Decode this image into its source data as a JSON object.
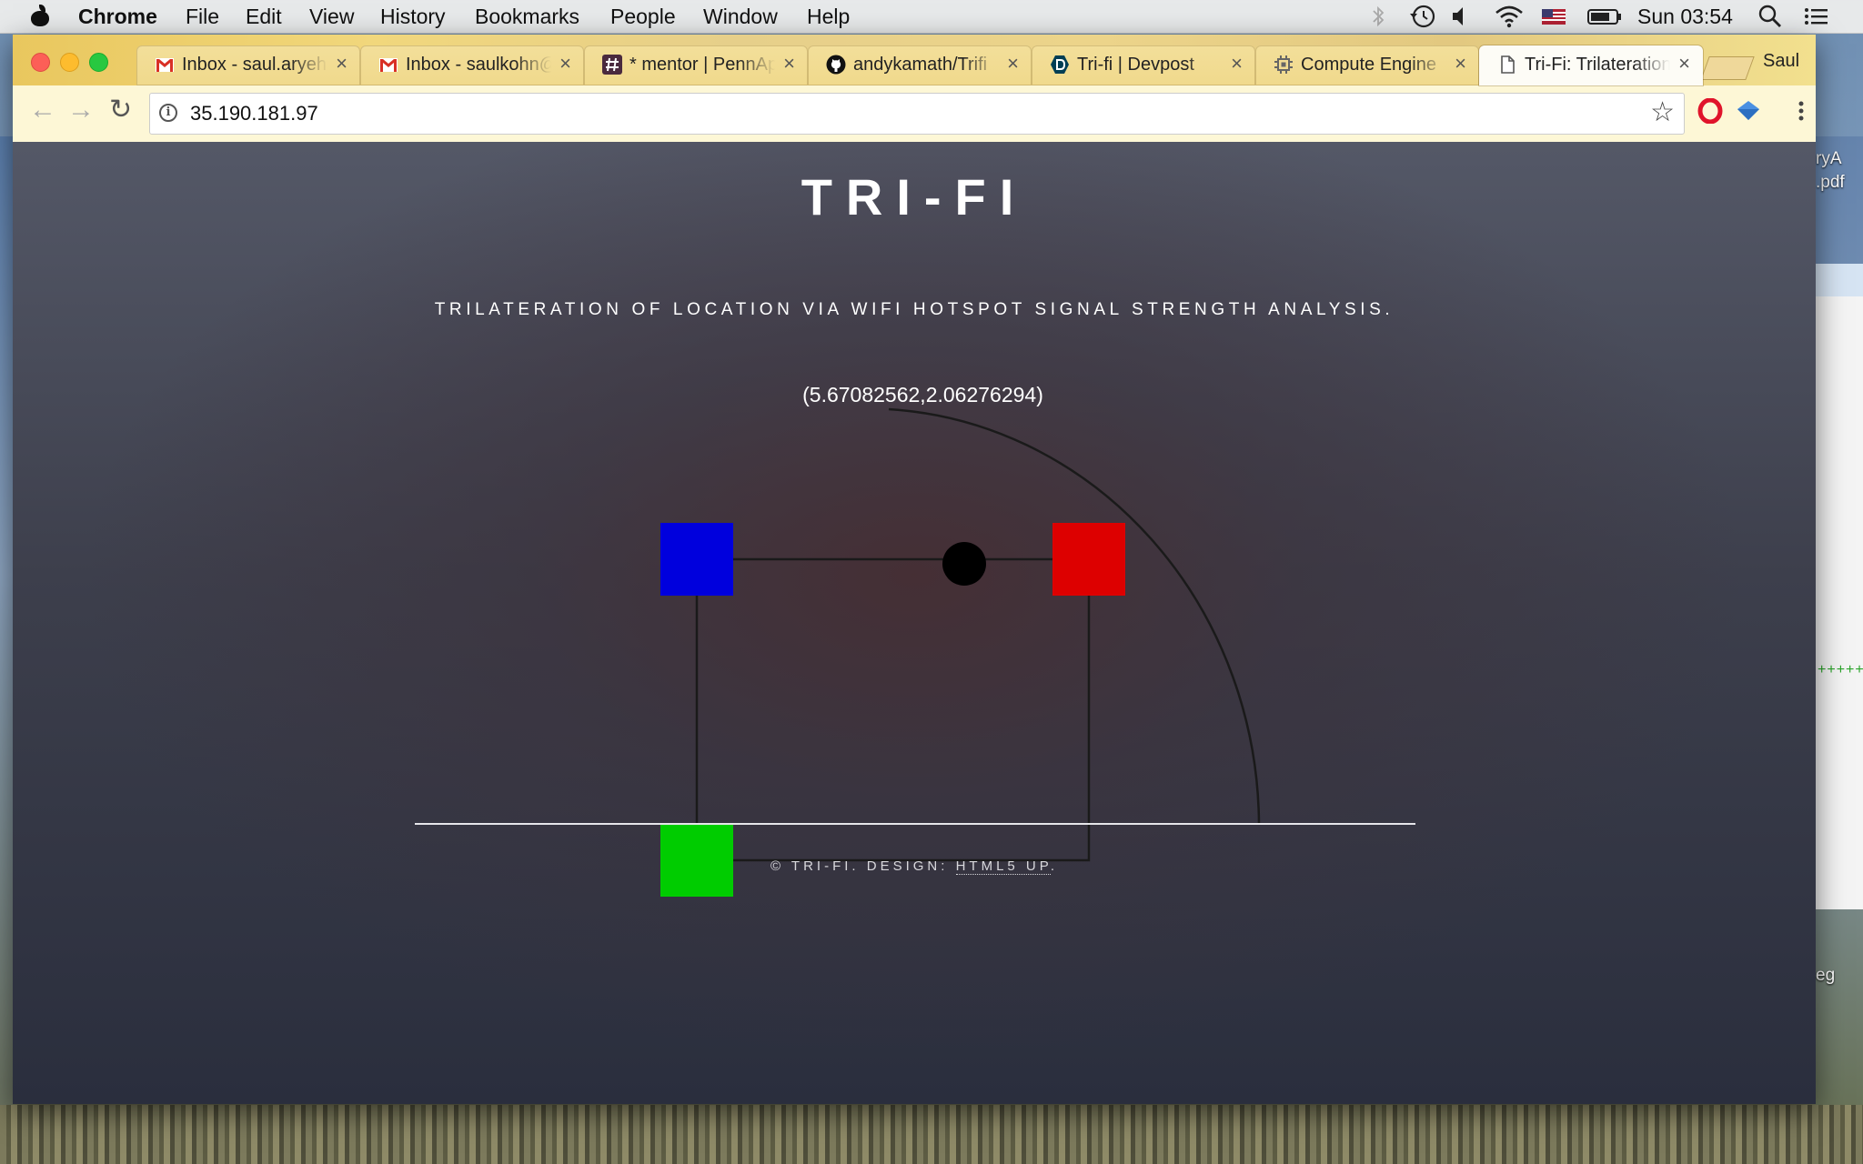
{
  "menubar": {
    "app": "Chrome",
    "items": [
      "File",
      "Edit",
      "View",
      "History",
      "Bookmarks",
      "People",
      "Window",
      "Help"
    ],
    "clock": "Sun 03:54"
  },
  "browser": {
    "tabs": [
      {
        "label": "Inbox - saul.aryeh",
        "icon": "gmail-icon"
      },
      {
        "label": "Inbox - saulkohn@",
        "icon": "gmail-icon"
      },
      {
        "label": "* mentor | PennApps",
        "icon": "slack-icon"
      },
      {
        "label": "andykamath/Trifi",
        "icon": "github-icon"
      },
      {
        "label": "Tri-fi | Devpost",
        "icon": "devpost-icon"
      },
      {
        "label": "Compute Engine",
        "icon": "compute-engine-icon"
      },
      {
        "label": "Tri-Fi: Trilateration",
        "icon": "document-icon",
        "active": true
      }
    ],
    "close_glyph": "×",
    "profile": "Saul",
    "url": "35.190.181.97"
  },
  "page": {
    "title": "TRI-FI",
    "subtitle": "TRILATERATION OF LOCATION VIA WIFI HOTSPOT SIGNAL STRENGTH ANALYSIS.",
    "coordinate": "(5.67082562,2.06276294)",
    "footer_prefix": "© TRI-FI. DESIGN: ",
    "footer_link": "HTML5 UP",
    "footer_suffix": "."
  },
  "diagram": {
    "hotspot_colors": {
      "top_left": "#0000dd",
      "top_right": "#dd0000",
      "bottom_left": "#00cc00"
    },
    "estimate_color": "#000000"
  },
  "desktop": {
    "side_labels": [
      "ryA",
      ".pdf",
      "eg"
    ],
    "side_green": "++++++"
  }
}
